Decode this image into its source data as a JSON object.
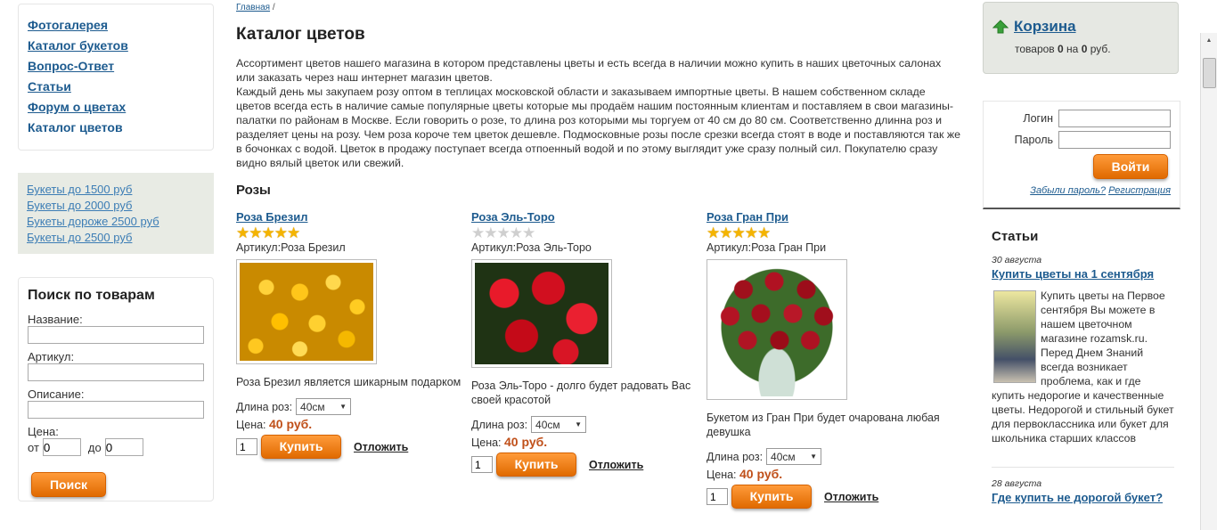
{
  "left_menu": {
    "items": [
      {
        "label": "Фотогалерея",
        "current": false
      },
      {
        "label": "Каталог букетов",
        "current": false
      },
      {
        "label": "Вопрос-Ответ",
        "current": false
      },
      {
        "label": "Статьи",
        "current": false
      },
      {
        "label": "Форум о цветах",
        "current": false
      },
      {
        "label": "Каталог цветов",
        "current": true
      }
    ]
  },
  "price_filters": [
    "Букеты до 1500 руб",
    "Букеты до 2000 руб",
    "Букеты дороже 2500 руб",
    "Букеты до 2500 руб"
  ],
  "search": {
    "title": "Поиск по товарам",
    "name_label": "Название:",
    "sku_label": "Артикул:",
    "desc_label": "Описание:",
    "price_label": "Цена:",
    "from_label": "от",
    "to_label": "до",
    "from_value": "0",
    "to_value": "0",
    "button": "Поиск"
  },
  "breadcrumb": {
    "home": "Главная",
    "separator": "/"
  },
  "page_title": "Каталог цветов",
  "intro": {
    "p1": "Ассортимент цветов нашего магазина в котором представлены цветы и есть всегда в наличии можно купить в наших цветочных салонах или заказать через наш интернет магазин цветов.",
    "p2": "Каждый день мы закупаем розу оптом в теплицах московской области и заказываем импортные цветы. В нашем собственном складе цветов всегда есть в наличие самые популярные цветы которые мы продаём нашим постоянным клиентам и поставляем в свои магазины-палатки по районам в Москве. Если говорить о розе, то длина роз которыми мы торгуем от 40 см до 80 см. Соответственно длинна роз и разделяет цены на розу. Чем роза короче тем цветок дешевле. Подмосковные розы после срезки всегда стоят в воде и поставляются так же в бочонках с водой. Цветок в продажу поступает всегда отпоенный водой и по этому выглядит уже сразу полный сил. Покупателю сразу видно вялый цветок или свежий."
  },
  "section_title": "Розы",
  "products": [
    {
      "name": "Роза Брезил",
      "rating": 5,
      "sku": "Артикул:Роза Брезил",
      "description": "Роза Брезил является шикарным подарком",
      "length_label": "Длина роз:",
      "length_value": "40см",
      "price_label": "Цена:",
      "price": "40 руб.",
      "qty": "1",
      "buy": "Купить",
      "defer": "Отложить"
    },
    {
      "name": "Роза Эль-Торо",
      "rating": 0,
      "sku": "Артикул:Роза Эль-Торо",
      "description": "Роза Эль-Торо - долго будет радовать Вас своей красотой",
      "length_label": "Длина роз:",
      "length_value": "40см",
      "price_label": "Цена:",
      "price": "40 руб.",
      "qty": "1",
      "buy": "Купить",
      "defer": "Отложить"
    },
    {
      "name": "Роза Гран При",
      "rating": 5,
      "sku": "Артикул:Роза Гран При",
      "description": "Букетом из Гран При будет очарована любая девушка",
      "length_label": "Длина роз:",
      "length_value": "40см",
      "price_label": "Цена:",
      "price": "40 руб.",
      "qty": "1",
      "buy": "Купить",
      "defer": "Отложить"
    }
  ],
  "cart": {
    "title": "Корзина",
    "text_before": "товаров",
    "count": "0",
    "text_mid": "на",
    "sum": "0",
    "currency": "руб."
  },
  "login": {
    "login_label": "Логин",
    "password_label": "Пароль",
    "button": "Войти",
    "forgot": "Забыли пароль?",
    "register": "Регистрация"
  },
  "articles": {
    "title": "Статьи",
    "items": [
      {
        "date": "30 августа",
        "title": "Купить цветы на 1 сентября",
        "body": "Купить цветы на Первое сентября Вы можете в нашем цветочном магазине rozamsk.ru. Перед Днем Знаний всегда возникает проблема, как и где купить недорогие и качественные цветы. Недорогой и стильный букет для первоклассника или букет для школьника старших классов"
      },
      {
        "date": "28 августа",
        "title": "Где купить не дорогой букет?"
      }
    ]
  },
  "colors": {
    "link": "#1d5b8f",
    "price": "#c0501a",
    "button": "#e87a10",
    "cart_bg": "#e6e8e3"
  }
}
